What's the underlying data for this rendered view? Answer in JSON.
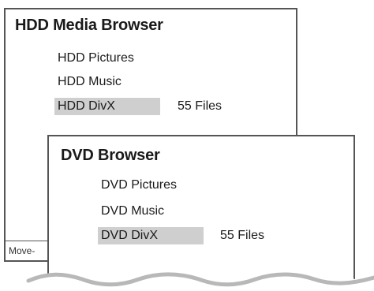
{
  "hdd_browser": {
    "title": "HDD Media Browser",
    "items": [
      {
        "label": "HDD Pictures"
      },
      {
        "label": "HDD Music"
      },
      {
        "label": "HDD DivX",
        "selected": true,
        "count": "55 Files"
      }
    ],
    "status_text": "Move-"
  },
  "dvd_browser": {
    "title": "DVD Browser",
    "items": [
      {
        "label": "DVD Pictures"
      },
      {
        "label": "DVD Music"
      },
      {
        "label": "DVD DivX",
        "selected": true,
        "count": "55 Files"
      }
    ]
  },
  "colors": {
    "border": "#555555",
    "selection": "#cfcfcf",
    "wave": "#b8b8b8"
  }
}
